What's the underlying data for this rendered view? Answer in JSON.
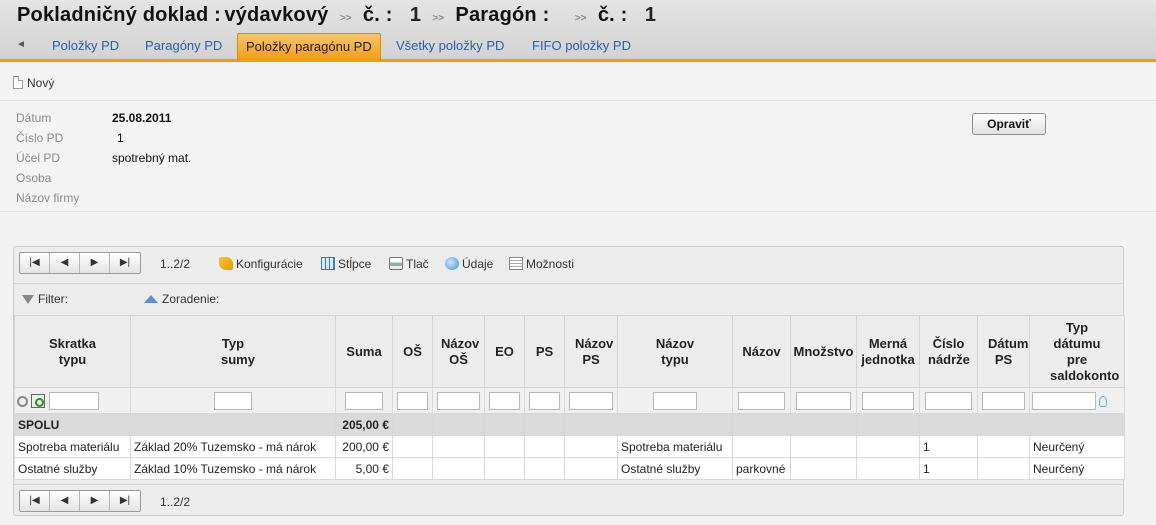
{
  "header": {
    "title": "Pokladničný doklad :",
    "type": "výdavkový",
    "sep": ">>",
    "no_label": "č. :",
    "doc_no": "1",
    "receipt_label": "Paragón :",
    "receipt_no": "1"
  },
  "tabs": [
    {
      "label": "Položky PD",
      "active": false
    },
    {
      "label": "Paragóny PD",
      "active": false
    },
    {
      "label": "Položky paragónu PD",
      "active": true
    },
    {
      "label": "Všetky položky PD",
      "active": false
    },
    {
      "label": "FIFO položky PD",
      "active": false
    }
  ],
  "toolbar": {
    "new_label": "Nový"
  },
  "form": {
    "fields": [
      {
        "label": "Dátum",
        "value": "25.08.2011"
      },
      {
        "label": "Číslo PD",
        "value": "1"
      },
      {
        "label": "Účel PD",
        "value": "spotrebný mat."
      },
      {
        "label": "Osoba",
        "value": ""
      },
      {
        "label": "Názov firmy",
        "value": ""
      }
    ],
    "edit_label": "Opraviť"
  },
  "grid": {
    "page_info": "1..2/2",
    "buttons": {
      "config": "Konfigurácie",
      "columns": "Stĺpce",
      "print": "Tlač",
      "data": "Údaje",
      "options": "Možnosti"
    },
    "filter_label": "Filter:",
    "sort_label": "Zoradenie:",
    "columns": [
      "Skratka typu",
      "Typ sumy",
      "Suma",
      "OŠ",
      "Názov OŠ",
      "EO",
      "PS",
      "Názov PS",
      "Názov typu",
      "Názov",
      "Množstvo",
      "Merná jednotka",
      "Číslo nádrže",
      "Dátum PS",
      "Typ dátumu pre saldokonto"
    ],
    "total": {
      "label": "SPOLU",
      "sum": "205,00 €"
    },
    "rows": [
      {
        "c0": "Spotreba materiálu",
        "c1": "Základ 20% Tuzemsko - má nárok",
        "c2": "200,00 €",
        "c3": "",
        "c4": "",
        "c5": "",
        "c6": "",
        "c7": "",
        "c8": "Spotreba materiálu",
        "c9": "",
        "c10": "",
        "c11": "",
        "c12": "1",
        "c13": "",
        "c14": "Neurčený"
      },
      {
        "c0": "Ostatné služby",
        "c1": "Základ 10% Tuzemsko - má nárok",
        "c2": "5,00 €",
        "c3": "",
        "c4": "",
        "c5": "",
        "c6": "",
        "c7": "",
        "c8": "Ostatné služby",
        "c9": "parkovné",
        "c10": "",
        "c11": "",
        "c12": "1",
        "c13": "",
        "c14": "Neurčený"
      }
    ]
  }
}
